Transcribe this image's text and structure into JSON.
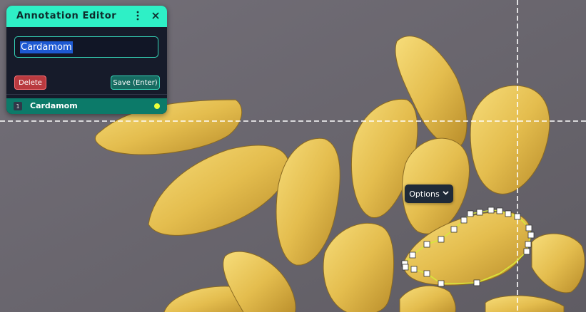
{
  "editor": {
    "title": "Annotation Editor",
    "name_value": "Cardamom",
    "delete_label": "Delete",
    "save_label": "Save (Enter)",
    "menu_icon": "more-vertical-icon",
    "close_icon": "close-icon"
  },
  "annotations": [
    {
      "index": "1",
      "label": "Cardamom",
      "dot_color": "#eaff3a"
    }
  ],
  "options": {
    "label": "Options",
    "icon": "chevron-down-icon"
  },
  "colors": {
    "accent": "#2ef0c6",
    "panel_bg": "#161b2a",
    "polygon_stroke": "#d8e83a",
    "list_active": "#0c7a69",
    "delete": "#b93a3f"
  }
}
